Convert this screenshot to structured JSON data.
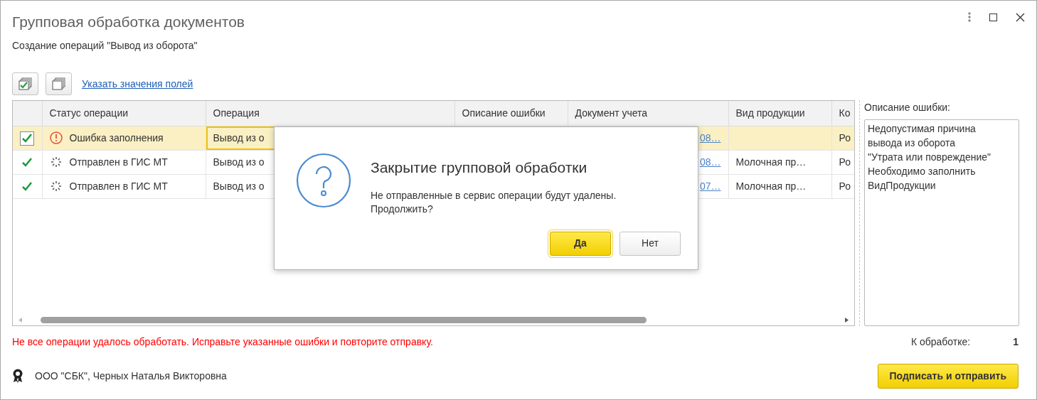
{
  "window": {
    "title": "Групповая обработка документов",
    "subtitle": "Создание операций \"Вывод из оборота\""
  },
  "toolbar": {
    "link": "Указать значения полей"
  },
  "table": {
    "columns": [
      "Статус операции",
      "Операция",
      "Описание ошибки",
      "Документ учета",
      "Вид продукции",
      "Ко"
    ],
    "rows": [
      {
        "selected": true,
        "checked": true,
        "kind": "error",
        "status": "Ошибка заполнения",
        "operation": "Вывод из о",
        "document": "08…",
        "column_7": "Ро"
      },
      {
        "selected": false,
        "checked": true,
        "kind": "sent",
        "status": "Отправлен в ГИС МТ",
        "operation": "Вывод из о",
        "document": "08…",
        "product": "Молочная пр…",
        "column_7": "Ро"
      },
      {
        "selected": false,
        "checked": true,
        "kind": "sent",
        "status": "Отправлен в ГИС МТ",
        "operation": "Вывод из о",
        "document": "07…",
        "product": "Молочная пр…",
        "column_7": "Ро"
      }
    ]
  },
  "side_panel": {
    "label": "Описание ошибки:",
    "text": "Недопустимая причина\nвывода из оборота\n\"Утрата или повреждение\"\nНеобходимо заполнить\nВидПродукции"
  },
  "status": {
    "error_message": "Не все операции удалось обработать. Исправьте указанные ошибки и повторите отправку.",
    "counter_label": "К обработке:",
    "counter_value": "1"
  },
  "footer": {
    "user": "ООО \"СБК\", Черных Наталья Викторовна",
    "button": "Подписать и отправить"
  },
  "dialog": {
    "title": "Закрытие групповой обработки",
    "message": "Не отправленные в сервис операции будут удалены.\nПродолжить?",
    "buttons": [
      {
        "label": "Да",
        "default": true
      },
      {
        "label": "Нет",
        "default": false
      }
    ]
  }
}
